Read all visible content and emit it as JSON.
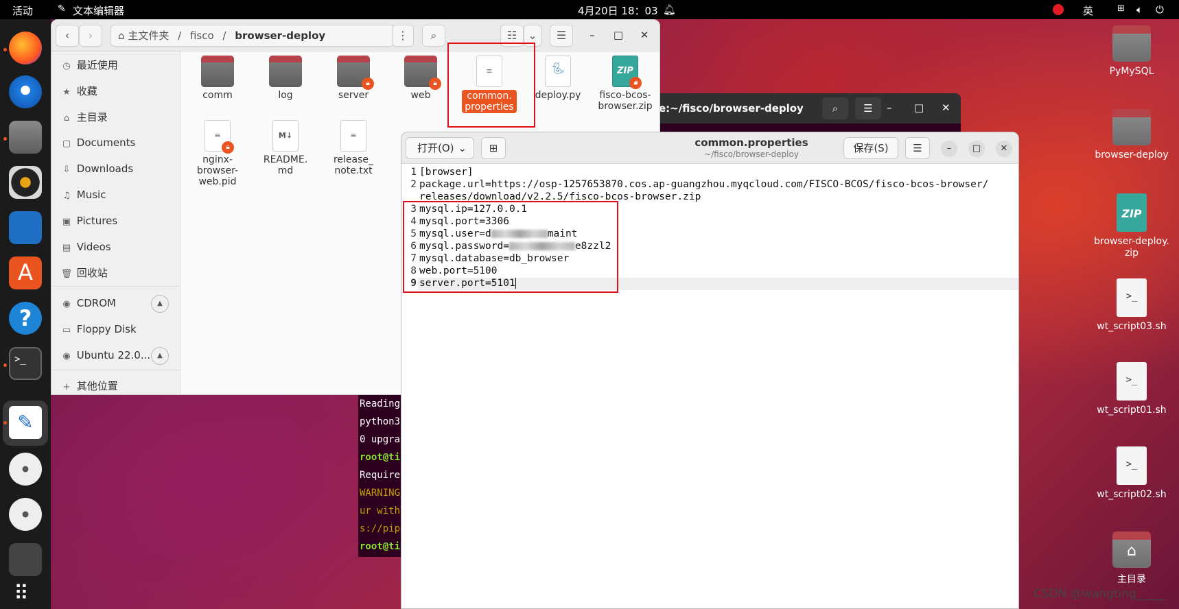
{
  "topbar": {
    "activities": "活动",
    "app_name": "文本编辑器",
    "datetime": "4月20日  18：03",
    "lang": "英"
  },
  "desktop": {
    "items": [
      {
        "label": "PyMySQL"
      },
      {
        "label": "browser-deploy"
      },
      {
        "label": "browser-deploy.\nzip",
        "zip_text": "ZIP"
      },
      {
        "label": "wt_script03.sh",
        "glyph": ">_"
      },
      {
        "label": "wt_script01.sh",
        "glyph": ">_"
      },
      {
        "label": "wt_script02.sh",
        "glyph": ">_"
      },
      {
        "label": "主目录"
      }
    ]
  },
  "file_manager": {
    "path": {
      "home": "主文件夹",
      "p1": "fisco",
      "p2": "browser-deploy"
    },
    "sidebar": {
      "items": [
        {
          "icon": "clock-icon",
          "label": "最近使用"
        },
        {
          "icon": "star-icon",
          "label": "收藏"
        },
        {
          "icon": "home-icon",
          "label": "主目录"
        },
        {
          "icon": "document-icon",
          "label": "Documents"
        },
        {
          "icon": "download-icon",
          "label": "Downloads"
        },
        {
          "icon": "music-icon",
          "label": "Music"
        },
        {
          "icon": "picture-icon",
          "label": "Pictures"
        },
        {
          "icon": "video-icon",
          "label": "Videos"
        },
        {
          "icon": "trash-icon",
          "label": "回收站"
        },
        {
          "icon": "disc-icon",
          "label": "CDROM"
        },
        {
          "icon": "disk-icon",
          "label": "Floppy Disk"
        },
        {
          "icon": "disc-icon",
          "label": "Ubuntu 22.0..."
        },
        {
          "icon": "plus-icon",
          "label": "其他位置"
        }
      ]
    },
    "files": [
      {
        "name": "comm",
        "type": "folder",
        "locked": false
      },
      {
        "name": "log",
        "type": "folder",
        "locked": false
      },
      {
        "name": "server",
        "type": "folder",
        "locked": true
      },
      {
        "name": "web",
        "type": "folder",
        "locked": true
      },
      {
        "name": "common.\nproperties",
        "type": "text",
        "selected": true
      },
      {
        "name": "deploy.py",
        "type": "python"
      },
      {
        "name": "fisco-bcos-\nbrowser.zip",
        "type": "zip",
        "locked": true,
        "zip_text": "ZIP"
      },
      {
        "name": "nginx-\nbrowser-\nweb.pid",
        "type": "text",
        "locked": true
      },
      {
        "name": "README.\nmd",
        "type": "markdown",
        "badge": "M↓"
      },
      {
        "name": "release_\nnote.txt",
        "type": "text"
      }
    ]
  },
  "terminal": {
    "title": "e:~/fisco/browser-deploy",
    "lines": [
      "Reading",
      "python3",
      "0 upgra",
      "root@ti",
      "Require",
      "WARNING",
      "ur with",
      "s://pip",
      "root@ti"
    ],
    "colors": {
      "prompt": "#8ae234",
      "warning": "#c4a000",
      "text": "#ffffff"
    }
  },
  "editor": {
    "open_label": "打开(O)",
    "title": "common.properties",
    "subtitle": "~/fisco/browser-deploy",
    "save_label": "保存(S)",
    "lines": [
      {
        "n": "1",
        "text": "[browser]"
      },
      {
        "n": "2",
        "text": "package.url=https://osp-1257653870.cos.ap-guangzhou.myqcloud.com/FISCO-BCOS/fisco-bcos-browser/"
      },
      {
        "n": "",
        "text": "releases/download/v2.2.5/fisco-bcos-browser.zip"
      },
      {
        "n": "3",
        "text": "mysql.ip=127.0.0.1"
      },
      {
        "n": "4",
        "text": "mysql.port=3306"
      },
      {
        "n": "5",
        "text_pre": "mysql.user=d",
        "text_post": "maint"
      },
      {
        "n": "6",
        "text_pre": "mysql.password=",
        "text_post": "e8zzl2"
      },
      {
        "n": "7",
        "text": "mysql.database=db_browser"
      },
      {
        "n": "8",
        "text": "web.port=5100"
      },
      {
        "n": "9",
        "text": "server.port=5101"
      }
    ]
  },
  "watermark": "CSDN @wangting_____",
  "colors": {
    "accent": "#e95420",
    "highlight_box": "#e0101a"
  }
}
